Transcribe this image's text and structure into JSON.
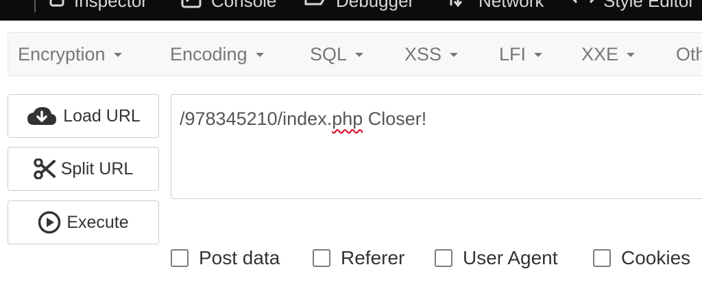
{
  "devtools": {
    "tabs": [
      {
        "label": "Inspector",
        "icon": "inspector-icon"
      },
      {
        "label": "Console",
        "icon": "console-icon"
      },
      {
        "label": "Debugger",
        "icon": "debugger-icon"
      },
      {
        "label": "Network",
        "icon": "network-icon"
      },
      {
        "label": "Style Editor",
        "icon": "style-editor-icon"
      }
    ]
  },
  "navbar": {
    "items": [
      {
        "label": "Encryption"
      },
      {
        "label": "Encoding"
      },
      {
        "label": "SQL"
      },
      {
        "label": "XSS"
      },
      {
        "label": "LFI"
      },
      {
        "label": "XXE"
      },
      {
        "label": "Other"
      }
    ]
  },
  "buttons": {
    "load_url": {
      "label": "Load URL",
      "icon": "cloud-download-icon"
    },
    "split_url": {
      "label": "Split URL",
      "icon": "scissors-icon"
    },
    "execute": {
      "label": "Execute",
      "icon": "play-circle-icon"
    }
  },
  "url": {
    "before": "/978345210/index.",
    "misspelled": "php",
    "after": " Closer!"
  },
  "options": {
    "post_data": "Post data",
    "referer": "Referer",
    "user_agent": "User Agent",
    "cookies": "Cookies"
  }
}
